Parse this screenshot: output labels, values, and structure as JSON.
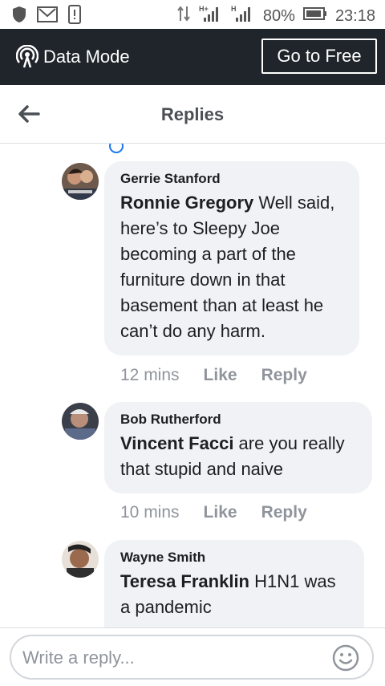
{
  "statusbar": {
    "battery": "80%",
    "time": "23:18",
    "network_1": "H+",
    "network_2": "H"
  },
  "datamode": {
    "label": "Data Mode",
    "button": "Go to Free"
  },
  "header": {
    "title": "Replies"
  },
  "comments": [
    {
      "author": "Gerrie Stanford",
      "mention": "Ronnie Gregory",
      "text": " Well said, here’s to Sleepy Joe becoming a part of the furniture down in that basement than at least he can’t do any harm.",
      "time": "12 mins",
      "like": "Like",
      "reply": "Reply"
    },
    {
      "author": "Bob Rutherford",
      "mention": "Vincent Facci",
      "text": " are you really that stupid and naive",
      "time": "10 mins",
      "like": "Like",
      "reply": "Reply"
    },
    {
      "author": "Wayne Smith",
      "mention": "Teresa Franklin",
      "text": " H1N1 was a pandemic"
    }
  ],
  "composer": {
    "placeholder": "Write a reply..."
  }
}
